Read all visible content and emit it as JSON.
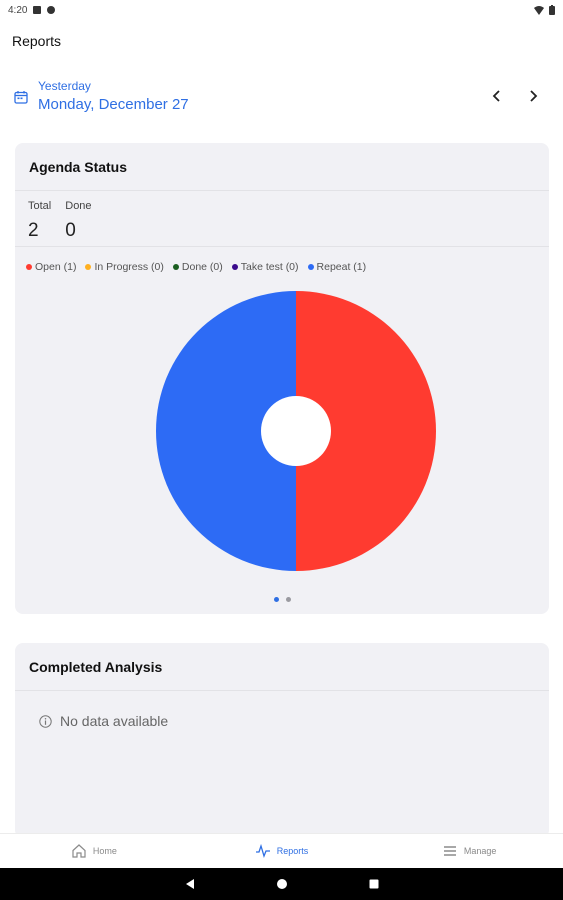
{
  "status_bar": {
    "time": "4:20"
  },
  "app": {
    "title": "Reports"
  },
  "date": {
    "relative": "Yesterday",
    "full": "Monday, December 27"
  },
  "agenda": {
    "title": "Agenda Status",
    "stats": [
      {
        "label": "Total",
        "value": "2"
      },
      {
        "label": "Done",
        "value": "0"
      }
    ],
    "legend": [
      {
        "label": "Open (1)",
        "color": "#ff3b30"
      },
      {
        "label": "In Progress (0)",
        "color": "#ffb020"
      },
      {
        "label": "Done (0)",
        "color": "#1b5e20"
      },
      {
        "label": "Take test (0)",
        "color": "#3a0a8c"
      },
      {
        "label": "Repeat (1)",
        "color": "#2d6bf5"
      }
    ]
  },
  "chart_data": {
    "type": "pie",
    "categories": [
      "Open",
      "In Progress",
      "Done",
      "Take test",
      "Repeat"
    ],
    "values": [
      1,
      0,
      0,
      0,
      1
    ],
    "colors": [
      "#ff3b30",
      "#ffb020",
      "#1b5e20",
      "#3a0a8c",
      "#2d6bf5"
    ],
    "donut": true,
    "legend_position": "top-left"
  },
  "pager": {
    "count": 2,
    "active": 0
  },
  "completed": {
    "title": "Completed Analysis",
    "empty_text": "No data available"
  },
  "bottom_nav": [
    {
      "label": "Home",
      "icon": "home-icon",
      "active": false
    },
    {
      "label": "Reports",
      "icon": "reports-icon",
      "active": true
    },
    {
      "label": "Manage",
      "icon": "menu-icon",
      "active": false
    }
  ]
}
